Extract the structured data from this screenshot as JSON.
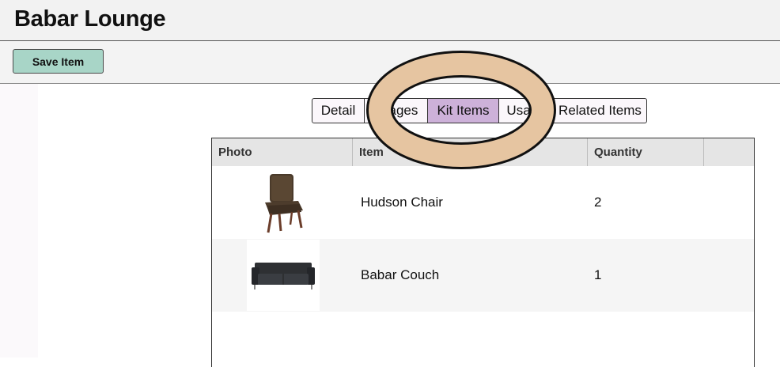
{
  "header": {
    "title": "Babar Lounge"
  },
  "toolbar": {
    "save_label": "Save Item"
  },
  "tabs": [
    {
      "label": "Detail",
      "active": false
    },
    {
      "label": "Images",
      "active": false
    },
    {
      "label": "Kit Items",
      "active": true
    },
    {
      "label": "Usage",
      "active": false
    },
    {
      "label": "Related Items",
      "active": false
    }
  ],
  "table": {
    "columns": [
      "Photo",
      "Item",
      "Quantity",
      ""
    ],
    "rows": [
      {
        "photo_icon": "chair-icon",
        "item": "Hudson Chair",
        "quantity": "2"
      },
      {
        "photo_icon": "couch-icon",
        "item": "Babar Couch",
        "quantity": "1"
      }
    ]
  },
  "colors": {
    "save_button": "#a8d5c7",
    "active_tab": "#cdb1d9",
    "annotation_ring": "#e6c5a1"
  },
  "annotation": {
    "shape": "ring-highlight"
  }
}
